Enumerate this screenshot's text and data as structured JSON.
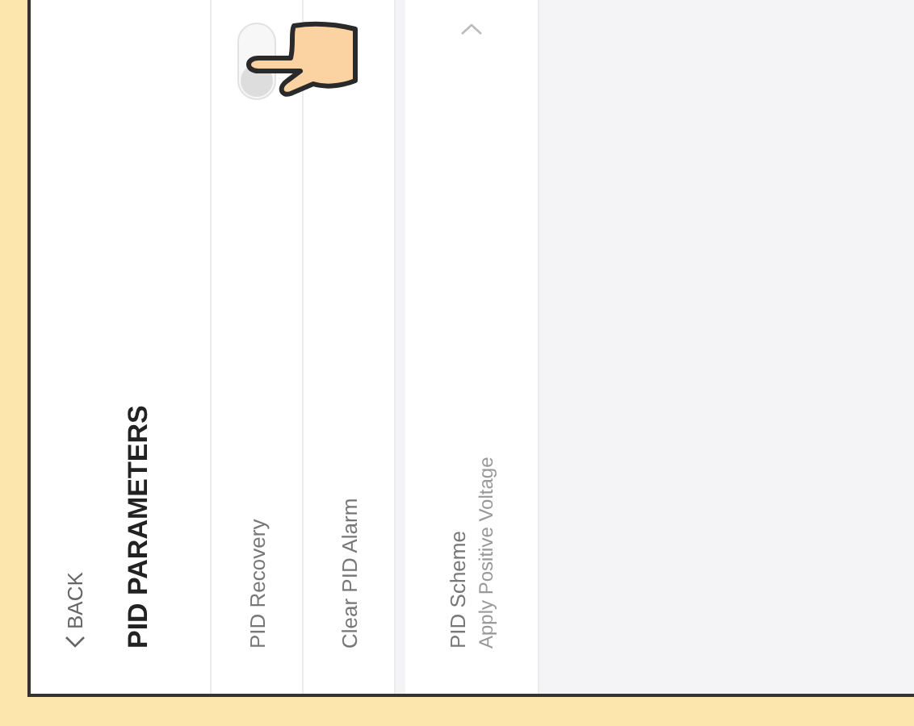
{
  "header": {
    "back": "BACK",
    "title": "PID PARAMETERS"
  },
  "groups": [
    [
      {
        "kind": "toggle",
        "label": "PID Recovery",
        "on": false
      },
      {
        "kind": "action",
        "label": "Clear PID Alarm"
      }
    ],
    [
      {
        "kind": "select",
        "label": "PID Scheme",
        "value": "Apply Positive Voltage"
      }
    ]
  ]
}
